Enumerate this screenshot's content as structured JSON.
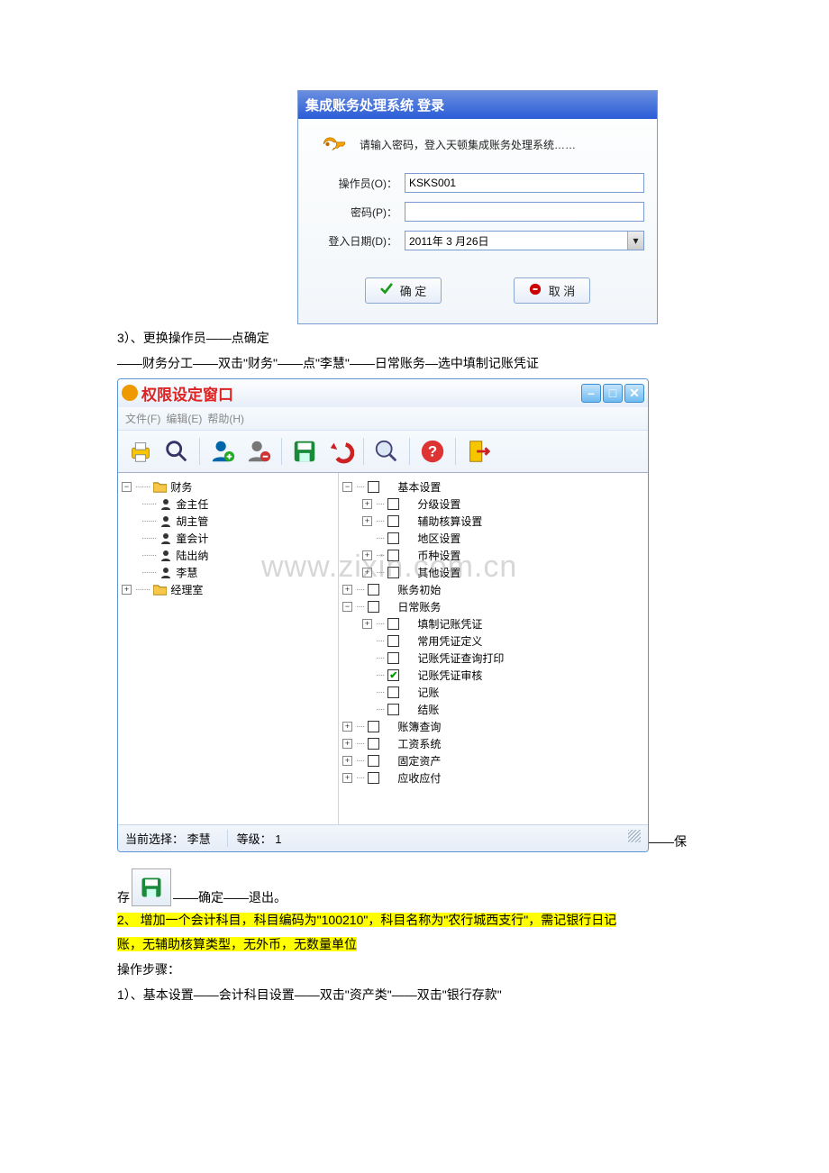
{
  "watermark": "www.zixin.com.cn",
  "login": {
    "title": "集成账务处理系统 登录",
    "hint": "请输入密码，登入天顿集成账务处理系统……",
    "operator_label": "操作员(O)：",
    "operator_value": "KSKS001",
    "password_label": "密码(P)：",
    "date_label": "登入日期(D)：",
    "date_value": "2011年 3 月26日",
    "ok": "确 定",
    "cancel": "取 消"
  },
  "para1": "3）、更换操作员——点确定",
  "para2": "——财务分工——双击\"财务\"——点\"李慧\"——日常账务—选中填制记账凭证",
  "perm": {
    "title": "权限设定窗口",
    "menu": {
      "file": "文件(F)",
      "edit": "编辑(E)",
      "help": "帮助(H)"
    },
    "left_tree": {
      "finance": "财务",
      "people": [
        "金主任",
        "胡主管",
        "童会计",
        "陆出纳",
        "李慧"
      ],
      "manager_office": "经理室"
    },
    "right_tree": {
      "basic": "基本设置",
      "basic_children": [
        "分级设置",
        "辅助核算设置",
        "地区设置",
        "币种设置",
        "其他设置"
      ],
      "acct_init": "账务初始",
      "daily": "日常账务",
      "daily_children": [
        "填制记账凭证",
        "常用凭证定义",
        "记账凭证查询打印",
        "记账凭证审核",
        "记账",
        "结账"
      ],
      "book_query": "账簿查询",
      "payroll": "工资系统",
      "fixed_assets": "固定资产",
      "arap": "应收应付"
    },
    "status_sel": "当前选择：  李慧",
    "status_level": "等级：  1"
  },
  "para3_prefix": "存",
  "para3_suffix": "——确定——退出。",
  "para3_dash": "——保",
  "hl1": "2、 增加一个会计科目，科目编码为\"100210\"，科目名称为\"农行城西支行\"，需记银行日记",
  "hl2": "账，无辅助核算类型，无外币，无数量单位",
  "para4": "操作步骤：",
  "para5": "1）、基本设置——会计科目设置——双击\"资产类\"——双击\"银行存款\""
}
